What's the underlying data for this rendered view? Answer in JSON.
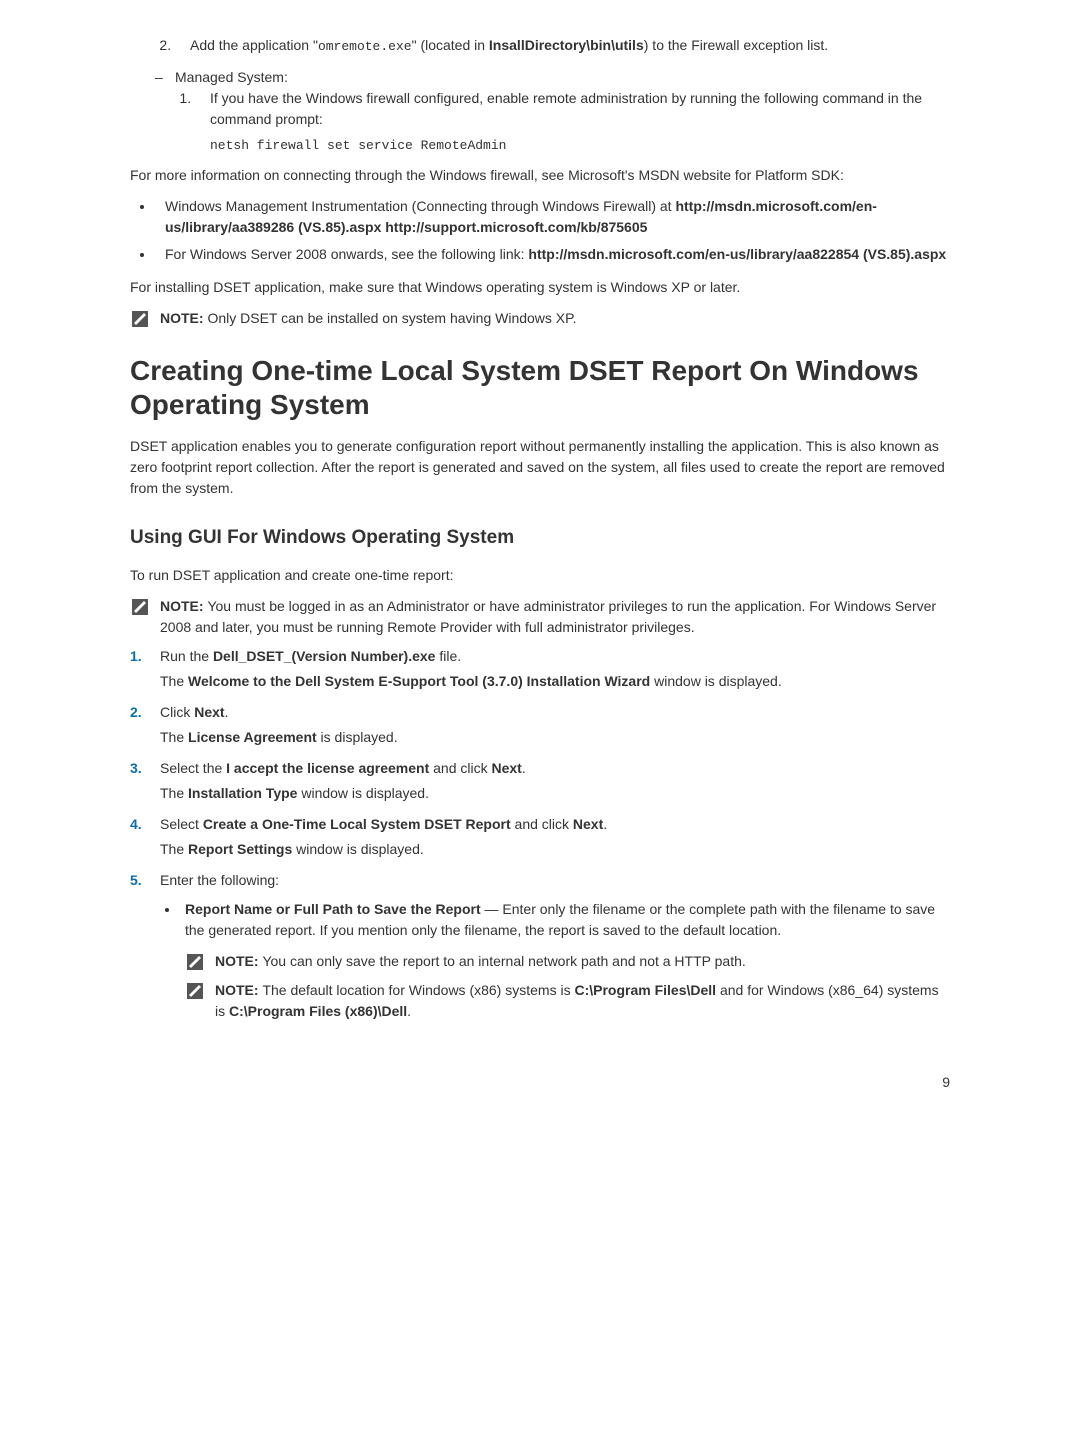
{
  "first_list": {
    "item2_prefix": "Add the application \"",
    "item2_code": "omremote.exe",
    "item2_mid": "\" (located in ",
    "item2_bold": "InsallDirectory\\bin\\utils",
    "item2_suffix": ") to the Firewall exception list.",
    "managed_system": "Managed System:",
    "managed_1": "If you have the Windows firewall configured, enable remote administration by running the following command in the command prompt:",
    "managed_code": "netsh firewall set service RemoteAdmin"
  },
  "para_firewall": "For more information on connecting through the Windows firewall, see Microsoft's MSDN website for Platform SDK:",
  "bullets_links": {
    "b1_text": "Windows Management Instrumentation (Connecting through Windows Firewall) at ",
    "b1_link": "http://msdn.microsoft.com/en-us/library/aa389286 (VS.85).aspx http://support.microsoft.com/kb/875605",
    "b2_text": "For Windows Server 2008 onwards, see the following link: ",
    "b2_link": "http://msdn.microsoft.com/en-us/library/aa822854 (VS.85).aspx"
  },
  "para_install": "For installing DSET application, make sure that Windows operating system is Windows XP or later.",
  "note1_label": "NOTE: ",
  "note1_text": "Only DSET can be installed on system having Windows XP.",
  "h1": "Creating One-time Local System DSET Report On Windows Operating System",
  "para_h1": "DSET application enables you to generate configuration report without permanently installing the application. This is also known as zero footprint report collection. After the report is generated and saved on the system, all files used to create the report are removed from the system.",
  "h2": "Using GUI For Windows Operating System",
  "para_h2": "To run DSET application and create one-time report:",
  "note2_label": "NOTE: ",
  "note2_text": "You must be logged in as an Administrator or have administrator privileges to run the application. For Windows Server 2008 and later, you must be running Remote Provider with full administrator privileges.",
  "steps": {
    "s1_a": "Run the ",
    "s1_b": "Dell_DSET_(Version Number).exe",
    "s1_c": " file.",
    "s1_sub_a": "The ",
    "s1_sub_b": "Welcome to the Dell System E-Support Tool (3.7.0) Installation Wizard",
    "s1_sub_c": " window is displayed.",
    "s2_a": "Click ",
    "s2_b": "Next",
    "s2_c": ".",
    "s2_sub_a": "The ",
    "s2_sub_b": "License Agreement",
    "s2_sub_c": " is displayed.",
    "s3_a": "Select the ",
    "s3_b": "I accept the license agreement",
    "s3_c": " and click ",
    "s3_d": "Next",
    "s3_e": ".",
    "s3_sub_a": "The ",
    "s3_sub_b": "Installation Type",
    "s3_sub_c": " window is displayed.",
    "s4_a": "Select ",
    "s4_b": "Create a One-Time Local System DSET Report",
    "s4_c": " and click ",
    "s4_d": "Next",
    "s4_e": ".",
    "s4_sub_a": "The ",
    "s4_sub_b": "Report Settings",
    "s4_sub_c": " window is displayed.",
    "s5": "Enter the following:",
    "s5_bullet_b": "Report Name or Full Path to Save the Report ",
    "s5_bullet_text": " — Enter only the filename or the complete path with the filename to save the generated report. If you mention only the filename, the report is saved to the default location.",
    "s5_note1_label": "NOTE: ",
    "s5_note1_text": "You can only save the report to an internal network path and not a HTTP path.",
    "s5_note2_label": "NOTE: ",
    "s5_note2_a": "The default location for Windows (x86) systems is ",
    "s5_note2_b": "C:\\Program Files\\Dell",
    "s5_note2_c": " and for Windows (x86_64) systems is ",
    "s5_note2_d": "C:\\Program Files (x86)\\Dell",
    "s5_note2_e": "."
  },
  "page_number": "9"
}
